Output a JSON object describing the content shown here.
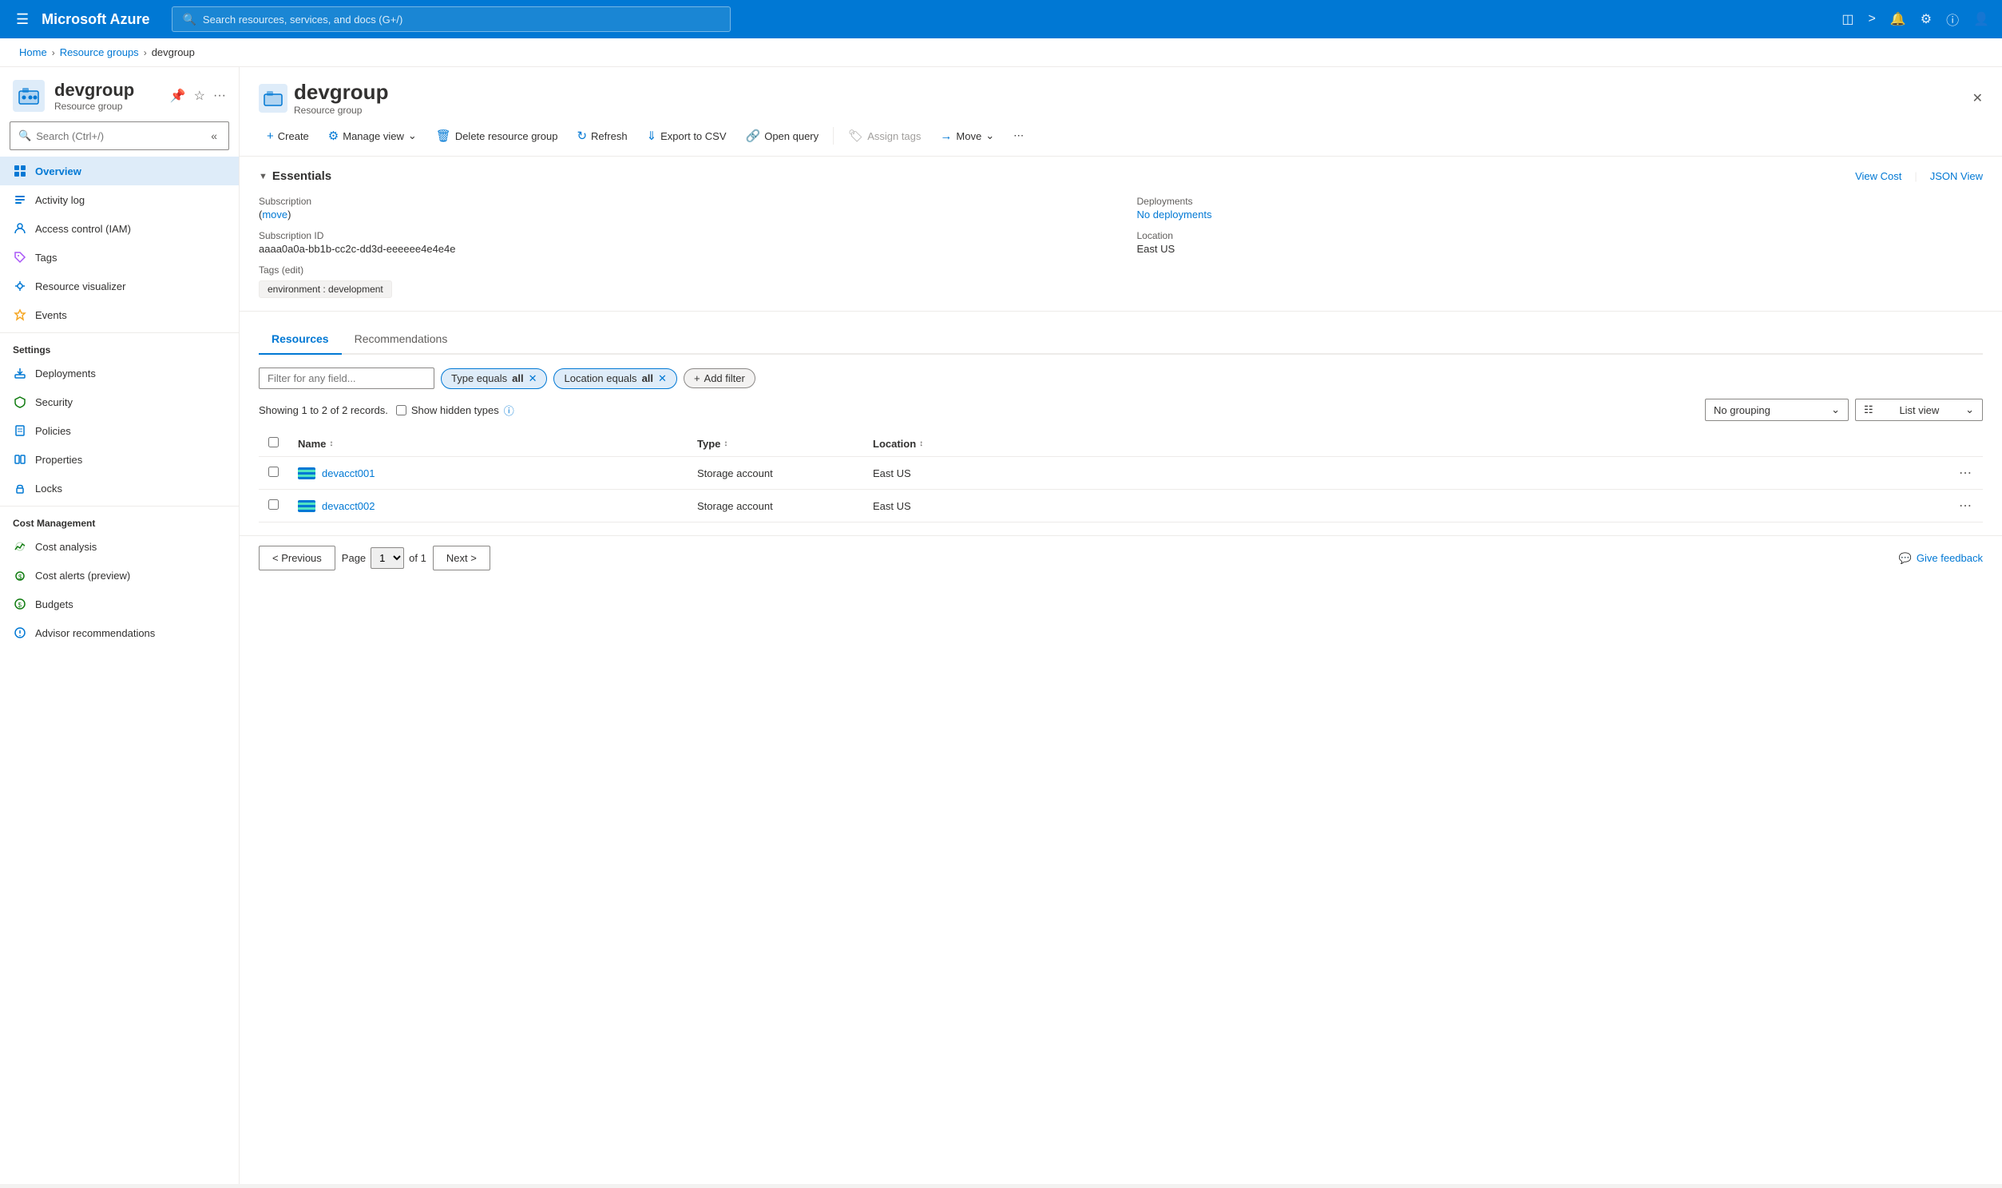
{
  "topnav": {
    "brand": "Microsoft Azure",
    "search_placeholder": "Search resources, services, and docs (G+/)",
    "icons": [
      "portal-icon",
      "cloud-shell-icon",
      "bell-icon",
      "settings-icon",
      "help-icon",
      "account-icon"
    ]
  },
  "breadcrumb": {
    "items": [
      "Home",
      "Resource groups"
    ],
    "current": "devgroup"
  },
  "resource": {
    "name": "devgroup",
    "type": "Resource group",
    "pin_label": "Pin",
    "favorite_label": "Favorite",
    "more_label": "More"
  },
  "sidebar": {
    "search_placeholder": "Search (Ctrl+/)",
    "nav_items": [
      {
        "id": "overview",
        "label": "Overview",
        "icon": "grid-icon",
        "active": true
      },
      {
        "id": "activity-log",
        "label": "Activity log",
        "icon": "list-icon"
      },
      {
        "id": "access-control",
        "label": "Access control (IAM)",
        "icon": "person-icon"
      },
      {
        "id": "tags",
        "label": "Tags",
        "icon": "tag-icon"
      },
      {
        "id": "resource-visualizer",
        "label": "Resource visualizer",
        "icon": "visualizer-icon"
      },
      {
        "id": "events",
        "label": "Events",
        "icon": "events-icon"
      }
    ],
    "settings_section": "Settings",
    "settings_items": [
      {
        "id": "deployments",
        "label": "Deployments",
        "icon": "deploy-icon"
      },
      {
        "id": "security",
        "label": "Security",
        "icon": "security-icon"
      },
      {
        "id": "policies",
        "label": "Policies",
        "icon": "policies-icon"
      },
      {
        "id": "properties",
        "label": "Properties",
        "icon": "properties-icon"
      },
      {
        "id": "locks",
        "label": "Locks",
        "icon": "locks-icon"
      }
    ],
    "cost_section": "Cost Management",
    "cost_items": [
      {
        "id": "cost-analysis",
        "label": "Cost analysis",
        "icon": "cost-icon"
      },
      {
        "id": "cost-alerts",
        "label": "Cost alerts (preview)",
        "icon": "alert-cost-icon"
      },
      {
        "id": "budgets",
        "label": "Budgets",
        "icon": "budgets-icon"
      },
      {
        "id": "advisor-recommendations",
        "label": "Advisor recommendations",
        "icon": "advisor-icon"
      }
    ]
  },
  "toolbar": {
    "create_label": "Create",
    "manage_view_label": "Manage view",
    "delete_label": "Delete resource group",
    "refresh_label": "Refresh",
    "export_label": "Export to CSV",
    "open_query_label": "Open query",
    "assign_tags_label": "Assign tags",
    "move_label": "Move"
  },
  "essentials": {
    "title": "Essentials",
    "view_cost_label": "View Cost",
    "json_view_label": "JSON View",
    "subscription_label": "Subscription",
    "subscription_move": "move",
    "subscription_id_label": "Subscription ID",
    "subscription_id_value": "aaaa0a0a-bb1b-cc2c-dd3d-eeeeee4e4e4e",
    "deployments_label": "Deployments",
    "deployments_value": "No deployments",
    "location_label": "Location",
    "location_value": "East US",
    "tags_label": "Tags",
    "tags_edit": "edit",
    "tags_value": "environment : development"
  },
  "resources": {
    "tab_resources": "Resources",
    "tab_recommendations": "Recommendations",
    "filter_placeholder": "Filter for any field...",
    "filter_type_label": "Type equals",
    "filter_type_value": "all",
    "filter_location_label": "Location equals",
    "filter_location_value": "all",
    "add_filter_label": "Add filter",
    "records_text": "Showing 1 to 2 of 2 records.",
    "show_hidden_label": "Show hidden types",
    "grouping_label": "No grouping",
    "list_view_label": "List view",
    "col_name": "Name",
    "col_type": "Type",
    "col_location": "Location",
    "rows": [
      {
        "name": "devacct001",
        "type": "Storage account",
        "location": "East US"
      },
      {
        "name": "devacct002",
        "type": "Storage account",
        "location": "East US"
      }
    ]
  },
  "pagination": {
    "previous_label": "< Previous",
    "page_label": "Page",
    "page_value": "1",
    "of_label": "of 1",
    "next_label": "Next >",
    "feedback_label": "Give feedback"
  }
}
